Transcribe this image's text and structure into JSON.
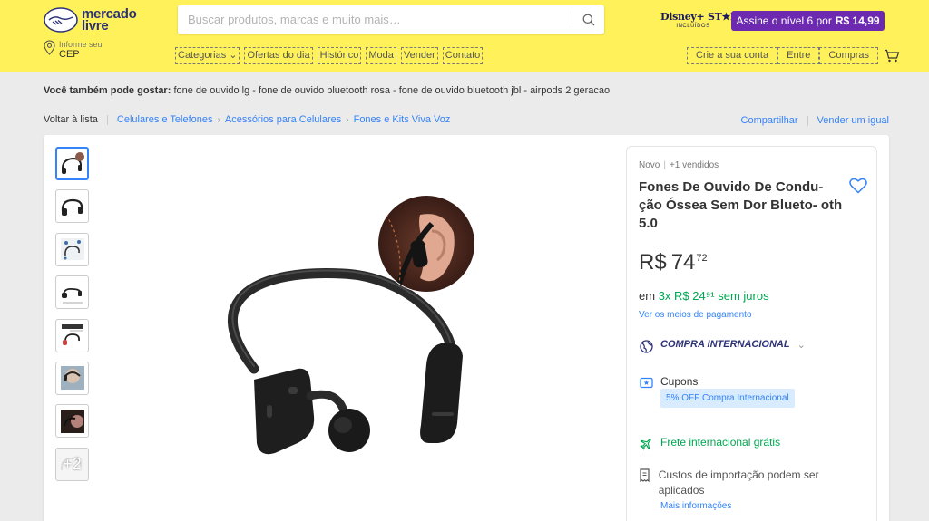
{
  "header": {
    "logo_line1": "mercado",
    "logo_line2": "livre",
    "search_placeholder": "Buscar produtos, marcas e muito mais…",
    "disney_main": "Disney+ ST★R+",
    "disney_sub": "INCLUÍDOS",
    "promo_text": "Assine o nível 6 por",
    "promo_price": "R$ 14,99",
    "cep_label": "Informe seu",
    "cep_value": "CEP",
    "nav": [
      "Categorias ⌄",
      "Ofertas do dia",
      "Histórico",
      "Moda",
      "Vender",
      "Contato"
    ],
    "account": [
      "Crie a sua conta",
      "Entre",
      "Compras"
    ]
  },
  "recs": {
    "label": "Você também pode gostar:",
    "items": "fone de ouvido lg - fone de ouvido bluetooth rosa - fone de ouvido bluetooth jbl - airpods 2 geracao"
  },
  "breadcrumb": {
    "back": "Voltar à lista",
    "items": [
      "Celulares e Telefones",
      "Acessórios para Celulares",
      "Fones e Kits Viva Voz"
    ]
  },
  "top_actions": {
    "share": "Compartilhar",
    "sell": "Vender um igual"
  },
  "gallery": {
    "more_count": "+2"
  },
  "product": {
    "condition": "Novo",
    "sold": "+1 vendidos",
    "title": "Fones De Ouvido De Condu- ção Óssea Sem Dor Blueto- oth 5.0",
    "price_currency": "R$",
    "price_int": "74",
    "price_cents": "72",
    "installments_prefix": "em",
    "installments": "3x R$ 24⁹¹ sem juros",
    "payment_link": "Ver os meios de pagamento",
    "international": "COMPRA INTERNACIONAL",
    "coupons_label": "Cupons",
    "coupon_badge": "5% OFF Compra Internacional",
    "freight": "Frete internacional grátis",
    "import_costs": "Custos de importação podem ser aplicados",
    "more_info": "Mais informações"
  },
  "colors": {
    "header_bg": "#fff159",
    "brand_blue": "#2d3277",
    "link_blue": "#3483fa",
    "green": "#00a650",
    "promo_purple": "#6d2ab1"
  }
}
